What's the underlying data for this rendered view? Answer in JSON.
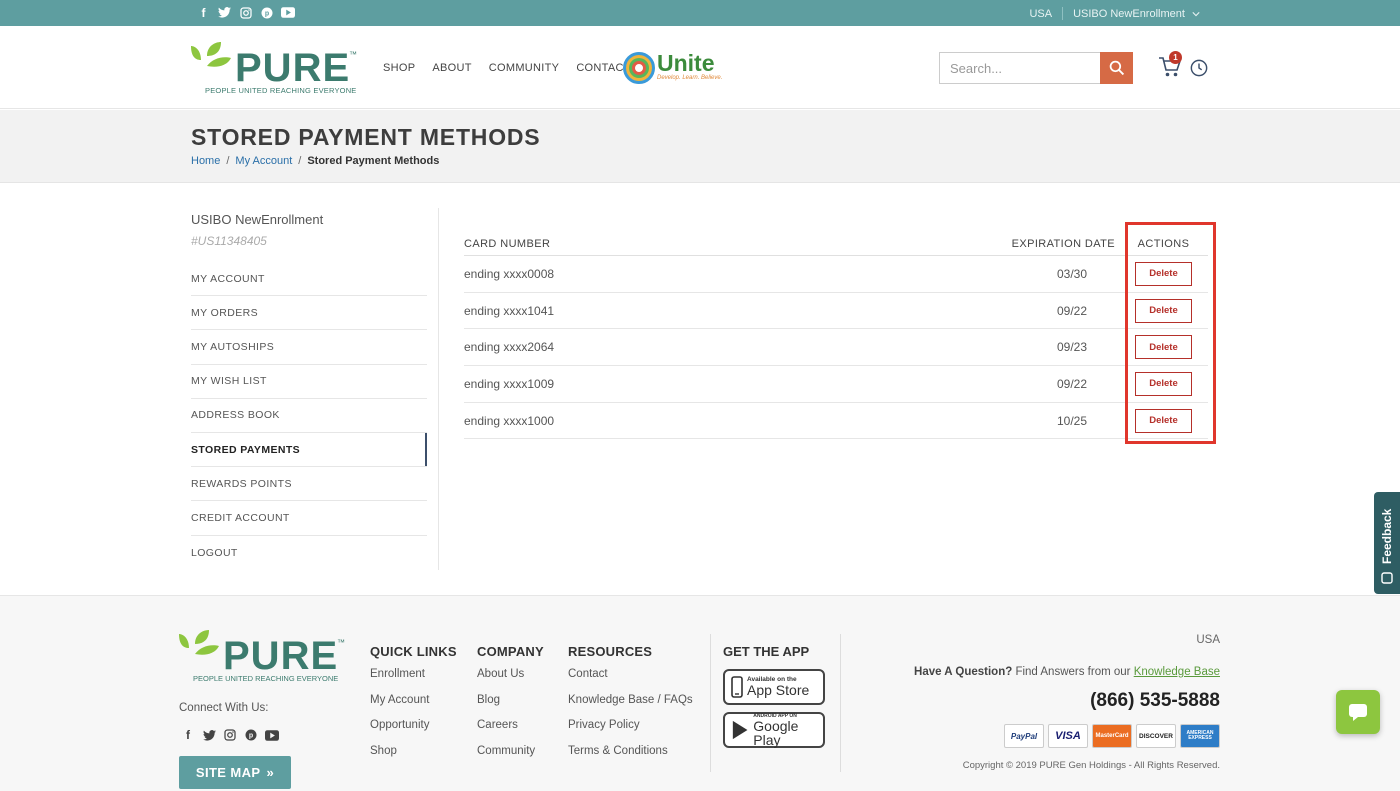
{
  "topbar": {
    "social": [
      "facebook-icon",
      "twitter-icon",
      "instagram-icon",
      "pinterest-icon",
      "youtube-icon"
    ],
    "country": "USA",
    "user": "USIBO NewEnrollment"
  },
  "header": {
    "logo_word": "PURE",
    "logo_tm": "™",
    "logo_tagline": "PEOPLE UNITED REACHING EVERYONE",
    "nav": [
      "SHOP",
      "ABOUT",
      "COMMUNITY",
      "CONTACT"
    ],
    "unite_word": "Unite",
    "unite_slogan": "Develop. Learn. Believe.",
    "search_placeholder": "Search...",
    "cart_count": "1"
  },
  "page": {
    "title": "STORED PAYMENT METHODS",
    "breadcrumb": [
      "Home",
      "My Account",
      "Stored Payment Methods"
    ],
    "breadcrumb_sep": "/"
  },
  "sidebar": {
    "account_name": "USIBO NewEnrollment",
    "account_id": "#US11348405",
    "items": [
      "MY ACCOUNT",
      "MY ORDERS",
      "MY AUTOSHIPS",
      "MY WISH LIST",
      "ADDRESS BOOK",
      "STORED PAYMENTS",
      "REWARDS POINTS",
      "CREDIT ACCOUNT",
      "LOGOUT"
    ],
    "active_index": 5
  },
  "payments": {
    "headers": [
      "CARD NUMBER",
      "EXPIRATION DATE",
      "ACTIONS"
    ],
    "delete_label": "Delete",
    "rows": [
      {
        "card": "ending xxxx0008",
        "exp": "03/30"
      },
      {
        "card": "ending xxxx1041",
        "exp": "09/22"
      },
      {
        "card": "ending xxxx2064",
        "exp": "09/23"
      },
      {
        "card": "ending xxxx1009",
        "exp": "09/22"
      },
      {
        "card": "ending xxxx1000",
        "exp": "10/25"
      }
    ]
  },
  "feedback_label": "Feedback",
  "footer": {
    "connect": "Connect With Us:",
    "sitemap": "SITE MAP",
    "sitemap_arrow": "»",
    "quick_links": {
      "title": "QUICK LINKS",
      "items": [
        "Enrollment",
        "My Account",
        "Opportunity",
        "Shop"
      ]
    },
    "company": {
      "title": "COMPANY",
      "items": [
        "About Us",
        "Blog",
        "Careers",
        "Community"
      ]
    },
    "resources": {
      "title": "RESOURCES",
      "items": [
        "Contact",
        "Knowledge Base / FAQs",
        "Privacy Policy",
        "Terms & Conditions"
      ]
    },
    "app": {
      "title": "GET THE APP",
      "appstore_small": "Available on the",
      "appstore_big": "App Store",
      "google_small": "ANDROID APP ON",
      "google_big": "Google Play"
    },
    "country": "USA",
    "question_bold": "Have A Question?",
    "question_text": " Find Answers from our ",
    "knowledge_base": "Knowledge Base",
    "phone": "(866) 535-5888",
    "cards": [
      "PayPal",
      "VISA",
      "MasterCard",
      "DISCOVER",
      "AMERICAN EXPRESS"
    ],
    "copyright": "Copyright © 2019 PURE Gen Holdings - All Rights Reserved."
  },
  "colors": {
    "teal": "#5e9ea0",
    "brand_green": "#3c7b6e",
    "search_button": "#d66a45",
    "delete_red": "#b5302a",
    "highlight_frame": "#e0362c",
    "chat_green": "#8dc63f"
  }
}
